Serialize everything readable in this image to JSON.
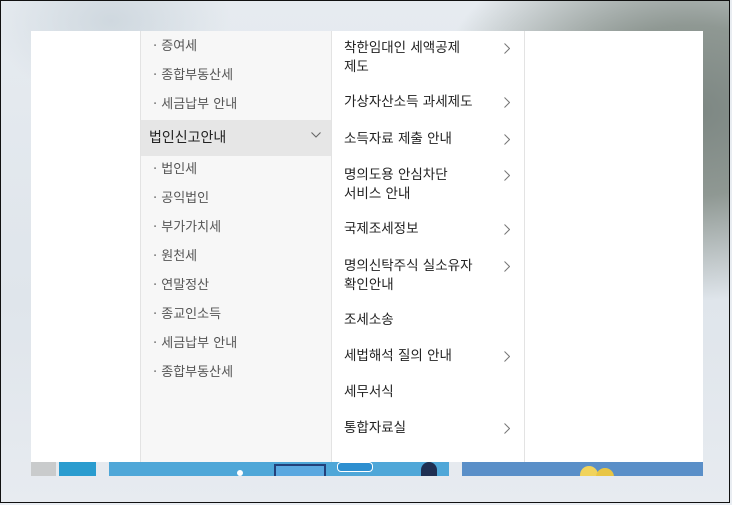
{
  "left_submenu": {
    "group_top": [
      "증여세",
      "종합부동산세",
      "세금납부 안내"
    ],
    "section_header": "법인신고안내",
    "group_bottom": [
      "법인세",
      "공익법인",
      "부가가치세",
      "원천세",
      "연말정산",
      "종교인소득",
      "세금납부 안내",
      "종합부동산세"
    ]
  },
  "right_menu": {
    "items": [
      {
        "label": "착한임대인 세액공제\n제도",
        "has_submenu": true
      },
      {
        "label": "가상자산소득 과세제도",
        "has_submenu": true
      },
      {
        "label": "소득자료 제출 안내",
        "has_submenu": true
      },
      {
        "label": "명의도용 안심차단\n서비스 안내",
        "has_submenu": true
      },
      {
        "label": "국제조세정보",
        "has_submenu": true
      },
      {
        "label": "명의신탁주식 실소유자\n확인안내",
        "has_submenu": true
      },
      {
        "label": "조세소송",
        "has_submenu": false
      },
      {
        "label": "세법해석 질의 안내",
        "has_submenu": true
      },
      {
        "label": "세무서식",
        "has_submenu": false
      },
      {
        "label": "통합자료실",
        "has_submenu": true
      }
    ]
  },
  "icons": {
    "section_toggle": "chevron-down-icon",
    "submenu_indicator": "chevron-right-icon"
  },
  "colors": {
    "header_bg": "#e6e6e6",
    "menu_bg": "#ffffff",
    "submenu_bg": "#f7f7f7",
    "text_dark": "#222222",
    "text_muted": "#555555"
  }
}
